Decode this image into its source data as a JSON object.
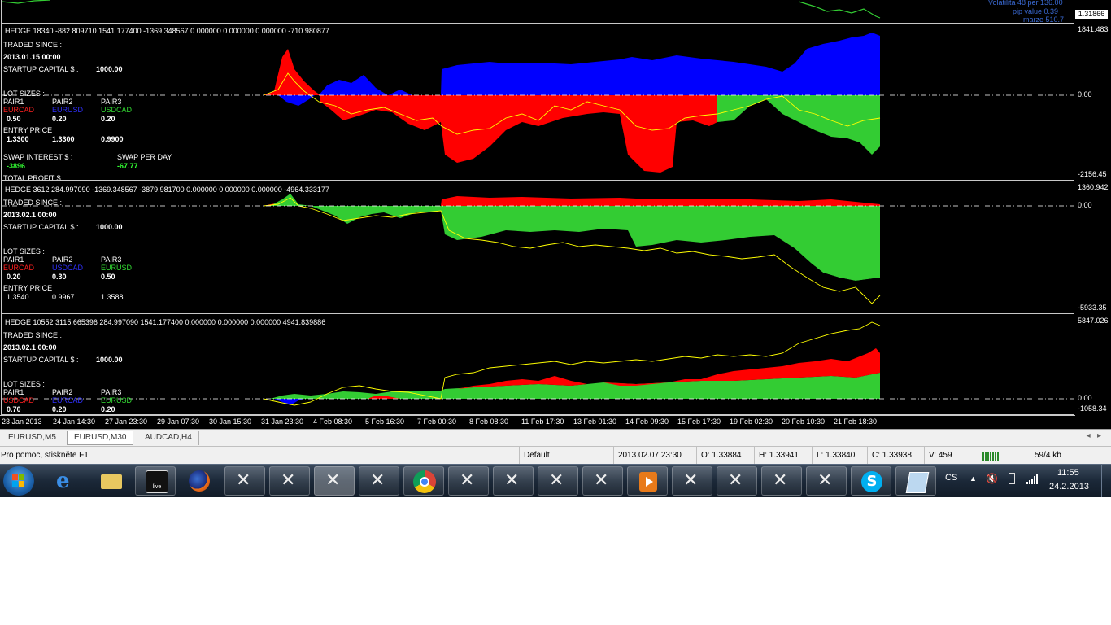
{
  "chart_window": {
    "top_strip": {
      "info_lines": [
        "Volatilita 48 per 136.00",
        "pip value   0.39",
        "marze   510.7"
      ],
      "price_box": "1.31866"
    },
    "panes": [
      {
        "header": "HEDGE 18340 -882.809710 1541.177400 -1369.348567 0.000000 0.000000 0.000000 -710.980877",
        "traded_since_label": "TRADED SINCE :",
        "traded_since_value": "2013.01.15 00:00",
        "startup_capital_label": "STARTUP CAPITAL $ :",
        "startup_capital_value": "1000.00",
        "lot_sizes_label": "LOT SIZES :",
        "pair_headers": [
          "PAIR1",
          "PAIR2",
          "PAIR3"
        ],
        "pair_names": [
          "EURCAD",
          "EURUSD",
          "USDCAD"
        ],
        "lots": [
          "0.50",
          "0.20",
          "0.20"
        ],
        "entry_price_label": "ENTRY PRICE",
        "entry_prices": [
          "1.3300",
          "1.3300",
          "0.9900"
        ],
        "swap_interest_label": "SWAP INTEREST $ :",
        "swap_interest_value": "-3896",
        "swap_per_day_label": "SWAP PER DAY",
        "swap_per_day_value": "-67.77",
        "total_profit_label": "TOTAL PROFIT $",
        "scale_max": "1841.483",
        "scale_zero": "0.00",
        "scale_min": "-2156.45"
      },
      {
        "header": "HEDGE 3612 284.997090 -1369.348567 -3879.981700 0.000000 0.000000 0.000000 -4964.333177",
        "traded_since_label": "TRADED SINCE :",
        "traded_since_value": "2013.02.1 00:00",
        "startup_capital_label": "STARTUP CAPITAL $ :",
        "startup_capital_value": "1000.00",
        "lot_sizes_label": "LOT SIZES :",
        "pair_headers": [
          "PAIR1",
          "PAIR2",
          "PAIR3"
        ],
        "pair_names": [
          "EURCAD",
          "USDCAD",
          "EURUSD"
        ],
        "lots": [
          "0.20",
          "0.30",
          "0.50"
        ],
        "entry_price_label": "ENTRY PRICE",
        "entry_prices": [
          "1.3540",
          "0.9967",
          "1.3588"
        ],
        "scale_max": "1360.942",
        "scale_zero": "0.00",
        "scale_min": "-5933.35"
      },
      {
        "header": "HEDGE 10552 3115.665396 284.997090 1541.177400 0.000000 0.000000 0.000000 4941.839886",
        "traded_since_label": "TRADED SINCE :",
        "traded_since_value": "2013.02.1 00:00",
        "startup_capital_label": "STARTUP CAPITAL $ :",
        "startup_capital_value": "1000.00",
        "lot_sizes_label": "LOT SIZES :",
        "pair_headers": [
          "PAIR1",
          "PAIR2",
          "PAIR3"
        ],
        "pair_names": [
          "USDCAD",
          "EURCAD",
          "EURUSD"
        ],
        "lots": [
          "0.70",
          "0.20",
          "0.20"
        ],
        "scale_max": "5847.026",
        "scale_zero": "0.00",
        "scale_min": "-1058.34"
      }
    ],
    "time_axis": [
      "23 Jan 2013",
      "24 Jan 14:30",
      "27 Jan 23:30",
      "29 Jan 07:30",
      "30 Jan 15:30",
      "31 Jan 23:30",
      "4 Feb 08:30",
      "5 Feb 16:30",
      "7 Feb 00:30",
      "8 Feb 08:30",
      "11 Feb 17:30",
      "13 Feb 01:30",
      "14 Feb 09:30",
      "15 Feb 17:30",
      "19 Feb 02:30",
      "20 Feb 10:30",
      "21 Feb 18:30"
    ],
    "colors": {
      "red": "#ff0000",
      "blue": "#0000ff",
      "green": "#33cc33",
      "yellow": "#ffff00",
      "background": "#000000"
    }
  },
  "tabs": [
    {
      "label": "EURUSD,M5",
      "active": false
    },
    {
      "label": "EURUSD,M30",
      "active": true
    },
    {
      "label": "AUDCAD,H4",
      "active": false
    }
  ],
  "status_bar": {
    "help": "Pro pomoc, stiskněte F1",
    "profile": "Default",
    "datetime": "2013.02.07 23:30",
    "open": "O: 1.33884",
    "high": "H: 1.33941",
    "low": "L: 1.33840",
    "close": "C: 1.33938",
    "volume": "V: 459",
    "traffic": "59/4 kb"
  },
  "taskbar": {
    "language": "CS",
    "time": "11:55",
    "date": "24.2.2013",
    "apps": [
      "start-button",
      "internet-explorer",
      "file-explorer",
      "live-app",
      "firefox",
      "metatrader",
      "metatrader",
      "metatrader",
      "metatrader",
      "chrome",
      "metatrader",
      "metatrader",
      "metatrader",
      "metatrader",
      "media-player",
      "metatrader",
      "metatrader",
      "metatrader",
      "metatrader",
      "skype",
      "notepad"
    ]
  }
}
